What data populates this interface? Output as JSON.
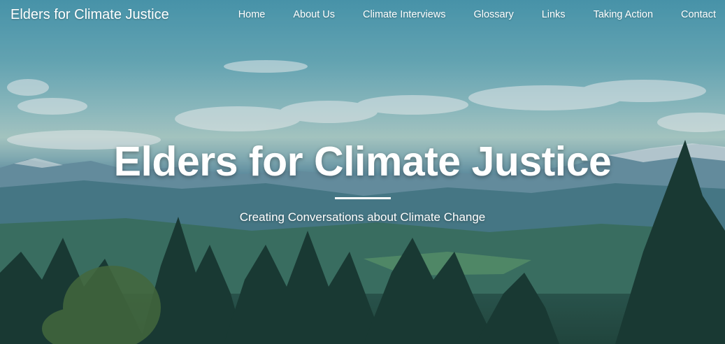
{
  "nav": {
    "brand": "Elders for Climate Justice",
    "links": [
      {
        "label": "Home"
      },
      {
        "label": "About Us"
      },
      {
        "label": "Climate Interviews"
      },
      {
        "label": "Glossary"
      },
      {
        "label": "Links"
      },
      {
        "label": "Taking Action"
      },
      {
        "label": "Contact"
      }
    ]
  },
  "hero": {
    "title": "Elders for Climate Justice",
    "subtitle": "Creating Conversations about Climate Change"
  },
  "colors": {
    "text": "#ffffff",
    "sky": "#6fb2c0",
    "forest": "#23463b"
  }
}
